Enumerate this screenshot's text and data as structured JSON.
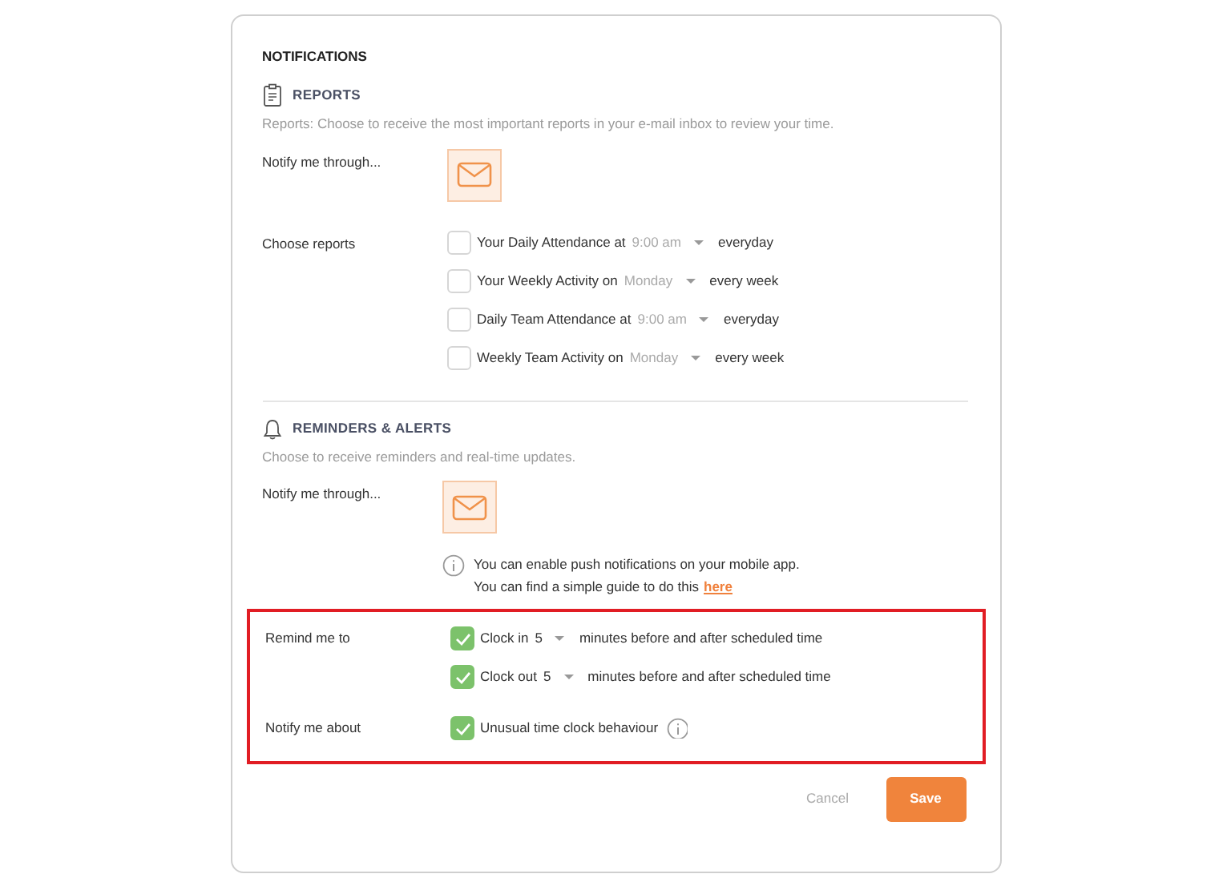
{
  "title": "NOTIFICATIONS",
  "reports": {
    "heading": "REPORTS",
    "description": "Reports: Choose to receive the most important reports in your e-mail inbox to review your time.",
    "notify_label": "Notify me through...",
    "email_selected": true,
    "choose_label": "Choose reports",
    "items": [
      {
        "label": "Your Daily Attendance at",
        "value": "9:00 am",
        "suffix": "everyday",
        "checked": false
      },
      {
        "label": "Your Weekly Activity on",
        "value": "Monday",
        "suffix": "every week",
        "checked": false
      },
      {
        "label": "Daily Team Attendance at",
        "value": "9:00 am",
        "suffix": "everyday",
        "checked": false
      },
      {
        "label": "Weekly Team Activity on",
        "value": "Monday",
        "suffix": "every week",
        "checked": false
      }
    ]
  },
  "reminders": {
    "heading": "REMINDERS & ALERTS",
    "description": "Choose to receive reminders and real-time updates.",
    "notify_label": "Notify me through...",
    "email_selected": true,
    "info_lines": [
      "You can enable push notifications on your mobile app.",
      "You can find a simple guide to do this"
    ],
    "info_link": "here",
    "highlighted": true,
    "groups": [
      {
        "label": "Remind me to",
        "items": [
          {
            "kind": "dropdown",
            "label": "Clock in",
            "value": "5",
            "suffix": "minutes before and after scheduled time",
            "checked": true
          },
          {
            "kind": "dropdown",
            "label": "Clock out",
            "value": "5",
            "suffix": "minutes before and after scheduled time",
            "checked": true
          }
        ]
      },
      {
        "label": "Notify me about",
        "items": [
          {
            "kind": "info",
            "label": "Unusual time clock behaviour",
            "checked": true
          }
        ]
      }
    ]
  },
  "buttons": {
    "cancel": "Cancel",
    "save": "Save"
  }
}
